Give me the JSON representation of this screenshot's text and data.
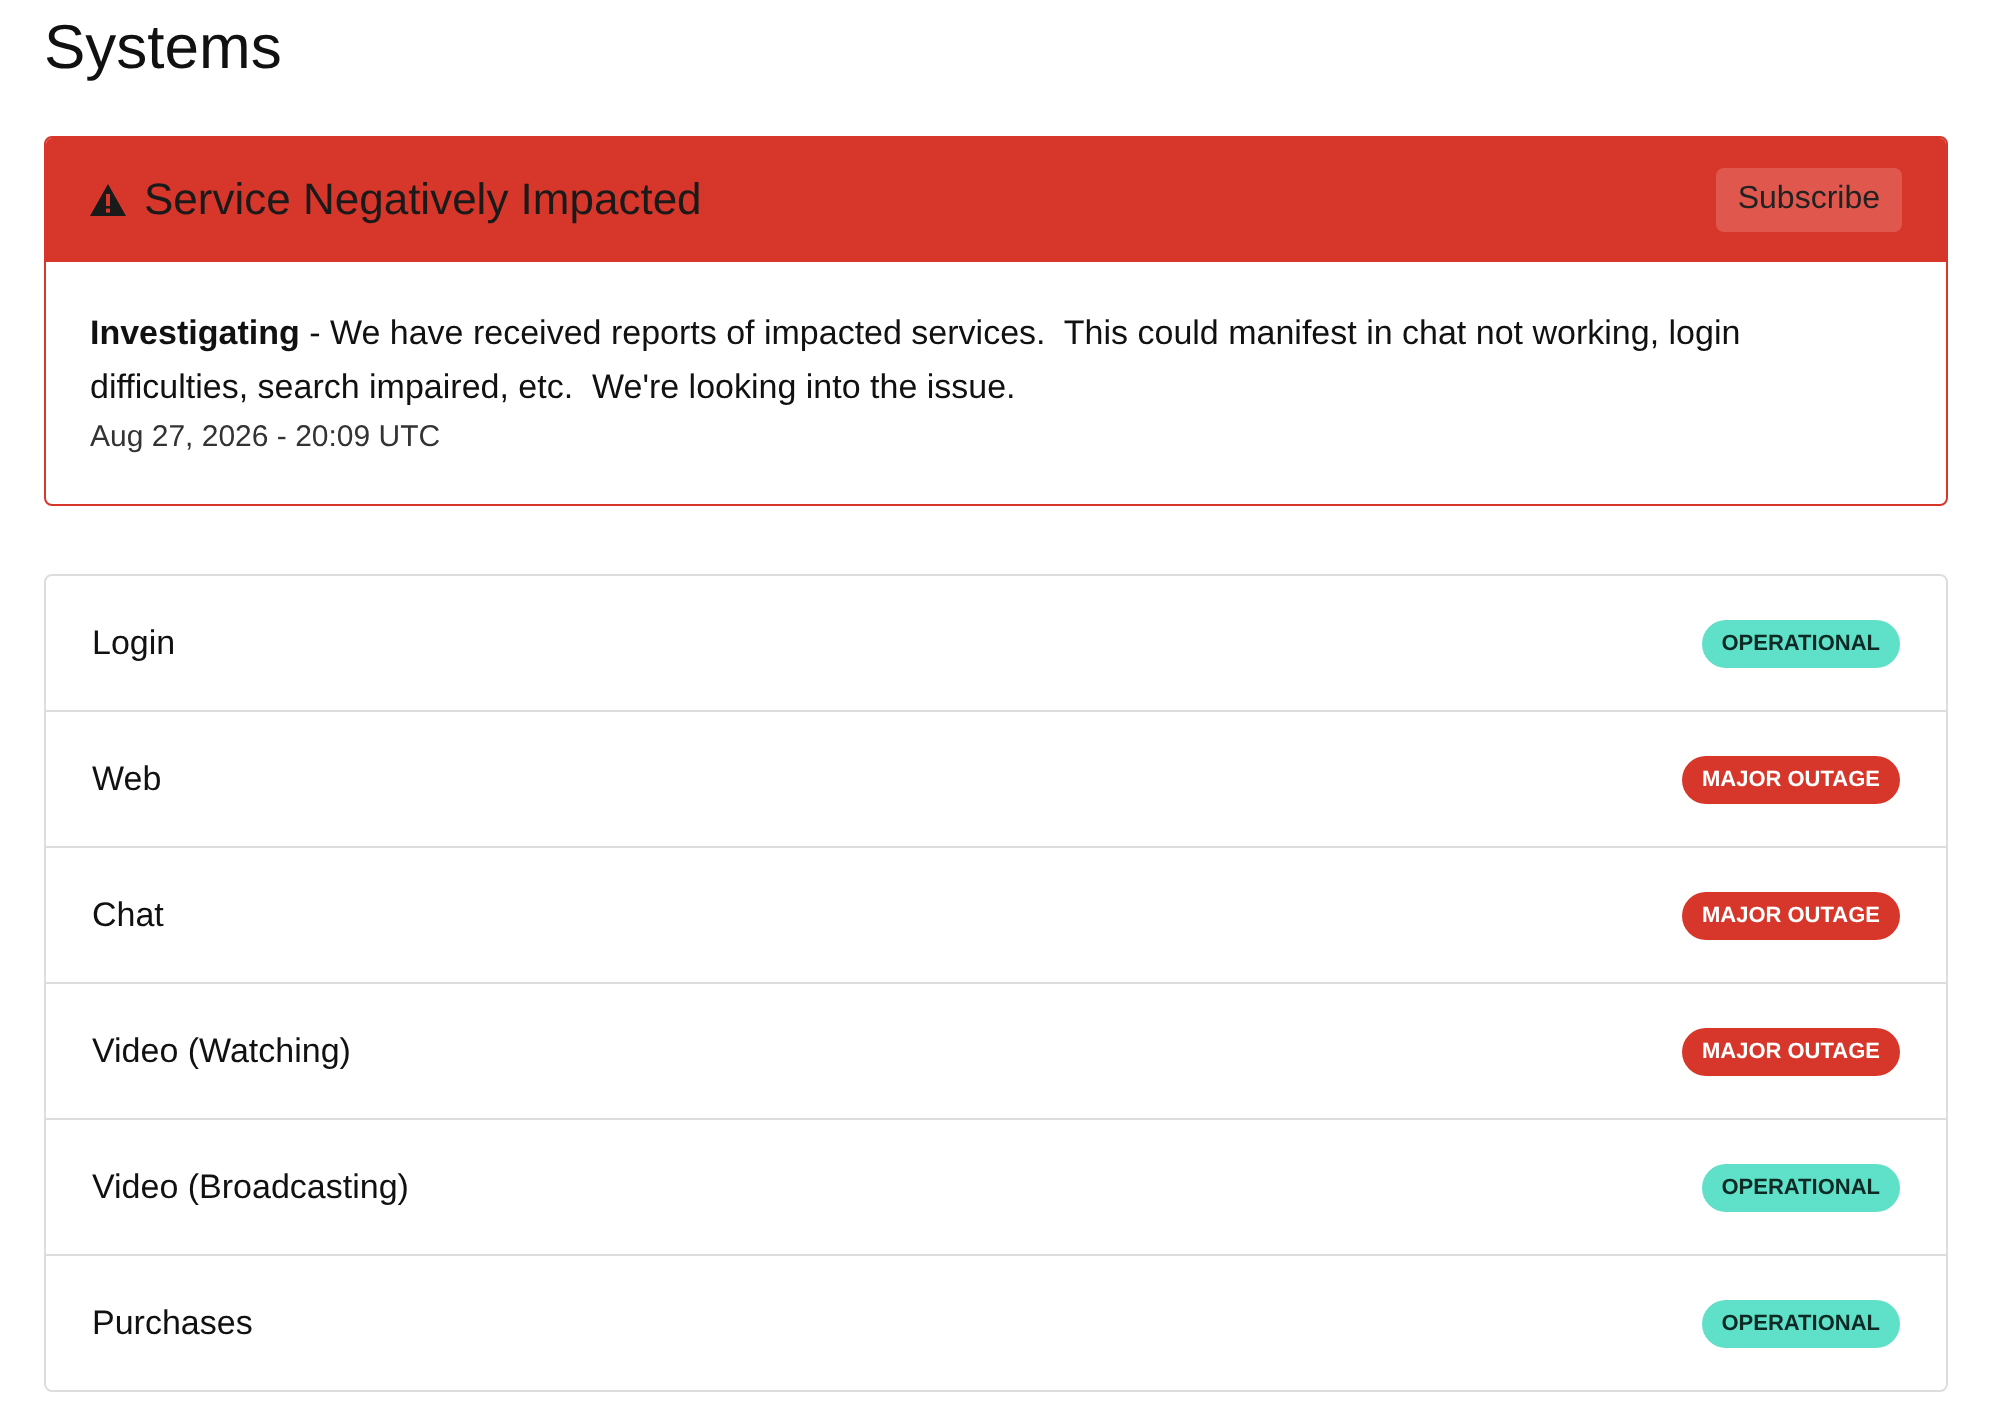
{
  "page_title": "Systems",
  "incident": {
    "title": "Service Negatively Impacted",
    "subscribe_button": "Subscribe",
    "update": "**Investigating** - We have received reports of impacted services.  This could manifest in chat not working, login difficulties, search impaired, etc.  We're looking into the issue.",
    "timestamp": "Aug 27, 2026 - 20:09 UTC"
  },
  "systems": [
    {
      "name": "Login",
      "status": "OPERATIONAL",
      "kind": "operational"
    },
    {
      "name": "Web",
      "status": "MAJOR OUTAGE",
      "kind": "major_outage"
    },
    {
      "name": "Chat",
      "status": "MAJOR OUTAGE",
      "kind": "major_outage"
    },
    {
      "name": "Video (Watching)",
      "status": "MAJOR OUTAGE",
      "kind": "major_outage"
    },
    {
      "name": "Video (Broadcasting)",
      "status": "OPERATIONAL",
      "kind": "operational"
    },
    {
      "name": "Purchases",
      "status": "OPERATIONAL",
      "kind": "operational"
    }
  ]
}
